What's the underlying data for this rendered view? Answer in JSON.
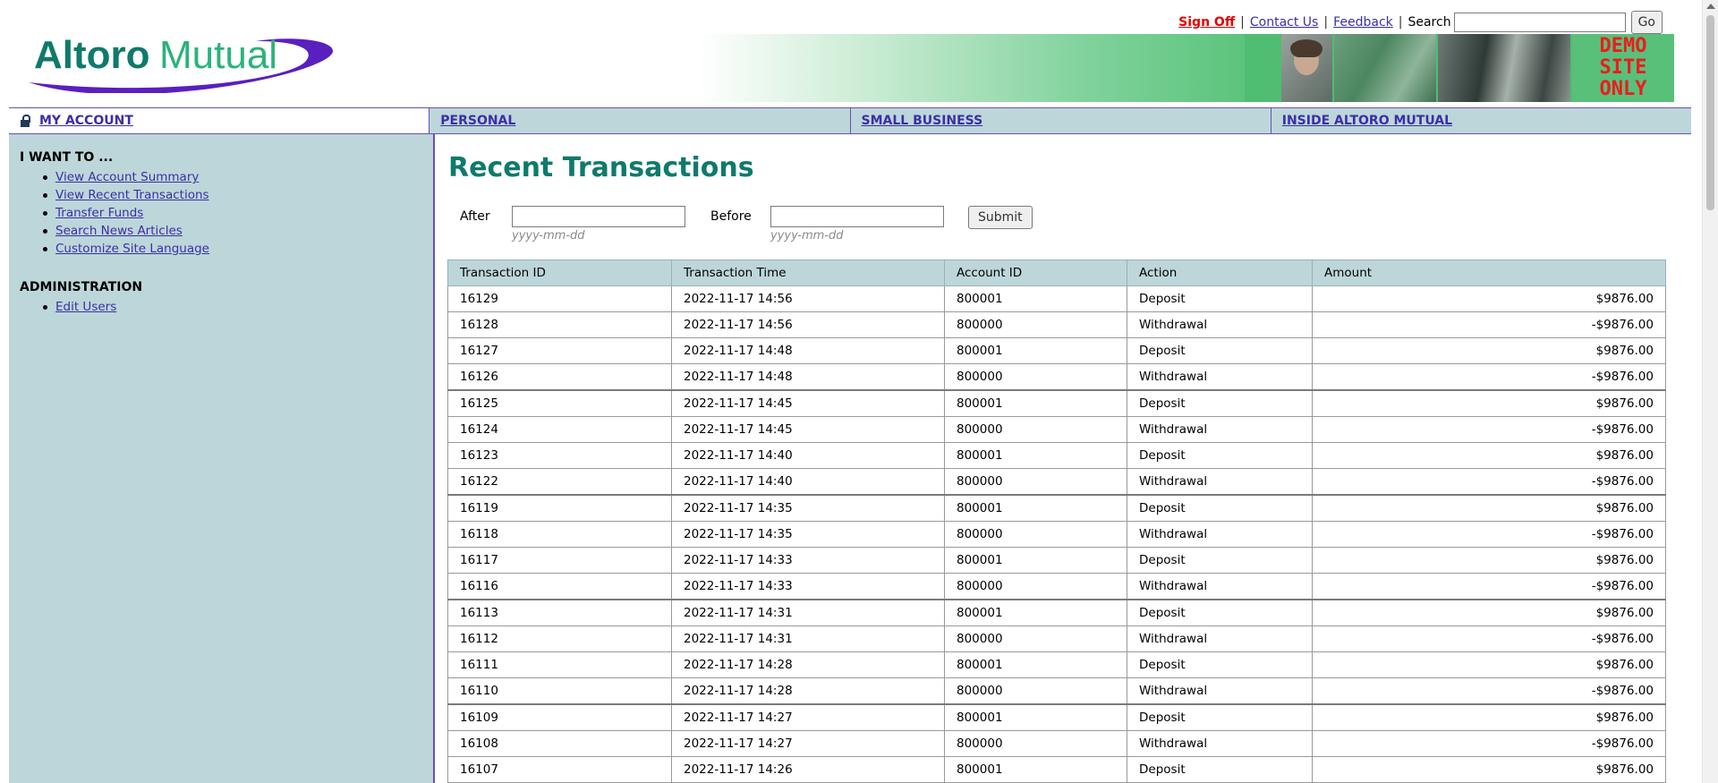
{
  "header": {
    "logo_text": "AltoroMutual",
    "links": {
      "sign_off": "Sign Off",
      "contact_us": "Contact Us",
      "feedback": "Feedback"
    },
    "separator": "|",
    "search_label": "Search",
    "search_value": "",
    "go_label": "Go",
    "banner_text": [
      "DEMO",
      "SITE",
      "ONLY"
    ]
  },
  "nav": {
    "tabs": [
      "MY ACCOUNT",
      "PERSONAL",
      "SMALL BUSINESS",
      "INSIDE ALTORO MUTUAL"
    ]
  },
  "sidebar": {
    "heading_1": "I WANT TO ...",
    "links_1": [
      "View Account Summary",
      "View Recent Transactions",
      "Transfer Funds",
      "Search News Articles",
      "Customize Site Language"
    ],
    "heading_2": "ADMINISTRATION",
    "links_2": [
      "Edit Users"
    ]
  },
  "main": {
    "title": "Recent Transactions",
    "after_label": "After",
    "before_label": "Before",
    "after_value": "",
    "before_value": "",
    "date_hint": "yyyy-mm-dd",
    "submit_label": "Submit",
    "table": {
      "headers": [
        "Transaction ID",
        "Transaction Time",
        "Account ID",
        "Action",
        "Amount"
      ],
      "rows": [
        [
          "16129",
          "2022-11-17 14:56",
          "800001",
          "Deposit",
          "$9876.00"
        ],
        [
          "16128",
          "2022-11-17 14:56",
          "800000",
          "Withdrawal",
          "-$9876.00"
        ],
        [
          "16127",
          "2022-11-17 14:48",
          "800001",
          "Deposit",
          "$9876.00"
        ],
        [
          "16126",
          "2022-11-17 14:48",
          "800000",
          "Withdrawal",
          "-$9876.00"
        ],
        [
          "16125",
          "2022-11-17 14:45",
          "800001",
          "Deposit",
          "$9876.00"
        ],
        [
          "16124",
          "2022-11-17 14:45",
          "800000",
          "Withdrawal",
          "-$9876.00"
        ],
        [
          "16123",
          "2022-11-17 14:40",
          "800001",
          "Deposit",
          "$9876.00"
        ],
        [
          "16122",
          "2022-11-17 14:40",
          "800000",
          "Withdrawal",
          "-$9876.00"
        ],
        [
          "16119",
          "2022-11-17 14:35",
          "800001",
          "Deposit",
          "$9876.00"
        ],
        [
          "16118",
          "2022-11-17 14:35",
          "800000",
          "Withdrawal",
          "-$9876.00"
        ],
        [
          "16117",
          "2022-11-17 14:33",
          "800001",
          "Deposit",
          "$9876.00"
        ],
        [
          "16116",
          "2022-11-17 14:33",
          "800000",
          "Withdrawal",
          "-$9876.00"
        ],
        [
          "16113",
          "2022-11-17 14:31",
          "800001",
          "Deposit",
          "$9876.00"
        ],
        [
          "16112",
          "2022-11-17 14:31",
          "800000",
          "Withdrawal",
          "-$9876.00"
        ],
        [
          "16111",
          "2022-11-17 14:28",
          "800001",
          "Deposit",
          "$9876.00"
        ],
        [
          "16110",
          "2022-11-17 14:28",
          "800000",
          "Withdrawal",
          "-$9876.00"
        ],
        [
          "16109",
          "2022-11-17 14:27",
          "800001",
          "Deposit",
          "$9876.00"
        ],
        [
          "16108",
          "2022-11-17 14:27",
          "800000",
          "Withdrawal",
          "-$9876.00"
        ],
        [
          "16107",
          "2022-11-17 14:26",
          "800001",
          "Deposit",
          "$9876.00"
        ]
      ]
    }
  },
  "colors": {
    "brand_teal": "#0e7a6c",
    "brand_purple": "#6a4fb0",
    "nav_bg": "#bdd6da",
    "sign_off_red": "#e60000"
  }
}
